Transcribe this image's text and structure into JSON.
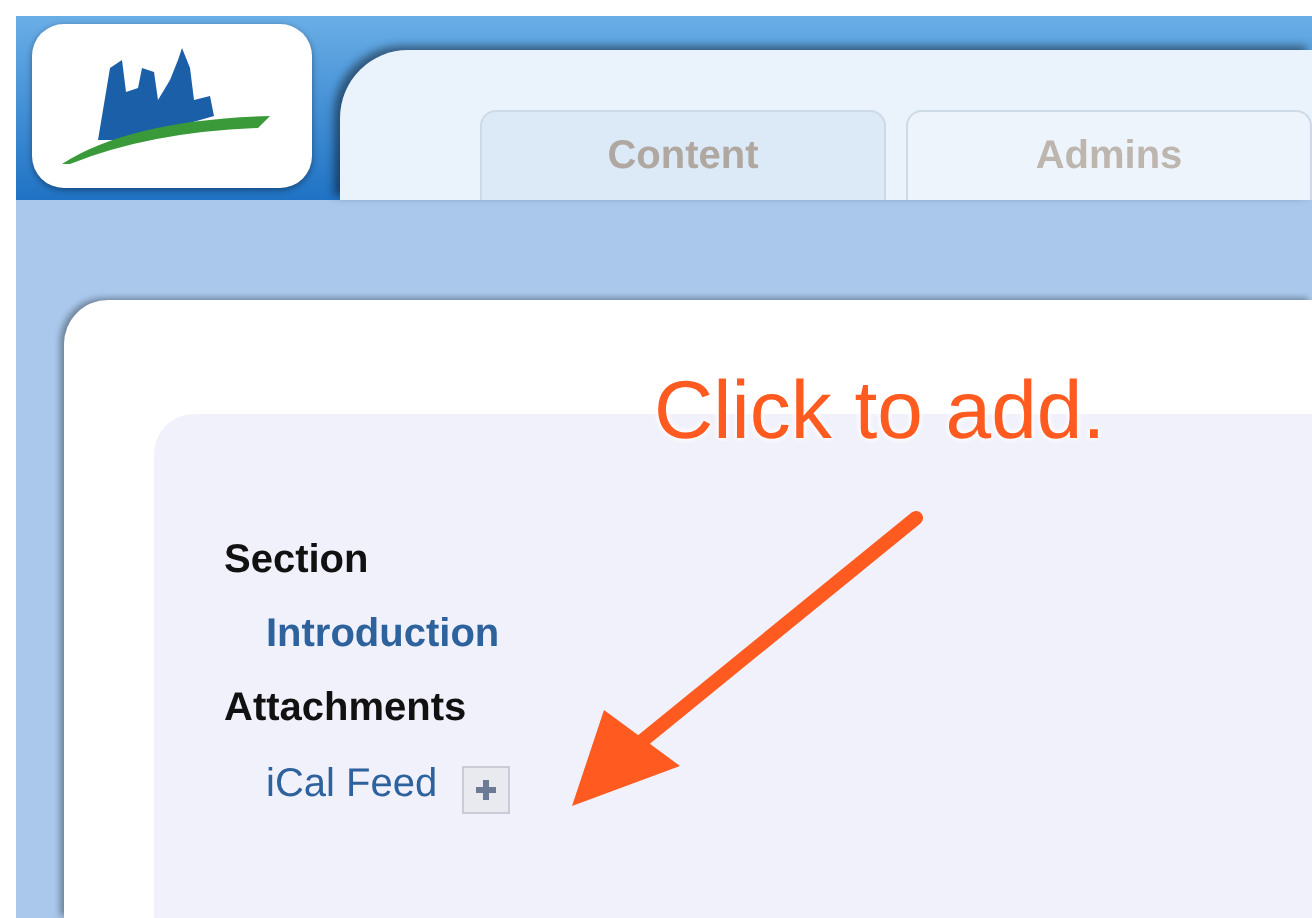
{
  "tabs": [
    {
      "label": "Content",
      "selected": true
    },
    {
      "label": "Admins",
      "selected": false
    }
  ],
  "sections": [
    {
      "heading": "Section",
      "items": [
        {
          "label": "Introduction",
          "kind": "link"
        }
      ]
    },
    {
      "heading": "Attachments",
      "items": [
        {
          "label": "iCal Feed",
          "kind": "add"
        }
      ]
    }
  ],
  "annotation": {
    "text": "Click to add."
  }
}
